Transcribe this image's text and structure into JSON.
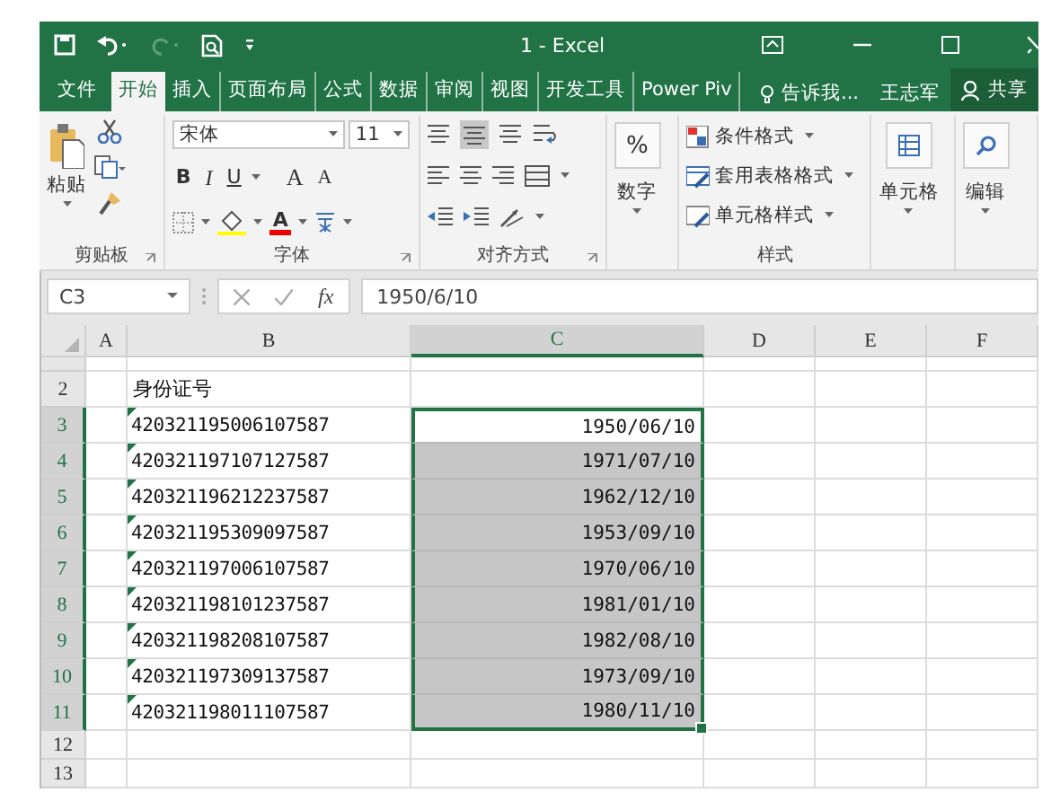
{
  "window": {
    "title": "1 - Excel"
  },
  "tabs": [
    {
      "label": "文件",
      "selected": false
    },
    {
      "label": "开始",
      "selected": true
    },
    {
      "label": "插入",
      "selected": false
    },
    {
      "label": "页面布局",
      "selected": false
    },
    {
      "label": "公式",
      "selected": false
    },
    {
      "label": "数据",
      "selected": false
    },
    {
      "label": "审阅",
      "selected": false
    },
    {
      "label": "视图",
      "selected": false
    },
    {
      "label": "开发工具",
      "selected": false
    },
    {
      "label": "Power Piv",
      "selected": false
    }
  ],
  "tell_me": "告诉我...",
  "user": "王志军",
  "share": "共享",
  "ribbon": {
    "clipboard": {
      "paste": "粘贴",
      "label": "剪贴板"
    },
    "font": {
      "font_name": "宋体",
      "font_size": "11",
      "bold": "B",
      "italic": "I",
      "underline": "U",
      "grow": "A",
      "shrink": "A",
      "font_color": "A",
      "label": "字体"
    },
    "alignment": {
      "label": "对齐方式"
    },
    "number": {
      "symbol": "%",
      "label": "数字"
    },
    "styles": {
      "items": [
        "条件格式",
        "套用表格格式",
        "单元格样式"
      ],
      "label": "样式"
    },
    "cells": {
      "label": "单元格"
    },
    "editing": {
      "label": "编辑"
    }
  },
  "formula_bar": {
    "name_box": "C3",
    "fx": "fx",
    "value": "1950/6/10"
  },
  "sheet": {
    "columns": [
      {
        "label": "A",
        "selected": false
      },
      {
        "label": "B",
        "selected": false
      },
      {
        "label": "C",
        "selected": true
      },
      {
        "label": "D",
        "selected": false
      },
      {
        "label": "E",
        "selected": false
      },
      {
        "label": "F",
        "selected": false
      }
    ],
    "rows": [
      {
        "header": "2",
        "selected": false,
        "id": "身份证号",
        "date": "",
        "flag": false,
        "cell_selected": false,
        "active": false
      },
      {
        "header": "3",
        "selected": true,
        "id": "420321195006107587",
        "date": "1950/06/10",
        "flag": true,
        "cell_selected": true,
        "active": true
      },
      {
        "header": "4",
        "selected": true,
        "id": "420321197107127587",
        "date": "1971/07/10",
        "flag": true,
        "cell_selected": true,
        "active": false
      },
      {
        "header": "5",
        "selected": true,
        "id": "420321196212237587",
        "date": "1962/12/10",
        "flag": true,
        "cell_selected": true,
        "active": false
      },
      {
        "header": "6",
        "selected": true,
        "id": "420321195309097587",
        "date": "1953/09/10",
        "flag": true,
        "cell_selected": true,
        "active": false
      },
      {
        "header": "7",
        "selected": true,
        "id": "420321197006107587",
        "date": "1970/06/10",
        "flag": true,
        "cell_selected": true,
        "active": false
      },
      {
        "header": "8",
        "selected": true,
        "id": "420321198101237587",
        "date": "1981/01/10",
        "flag": true,
        "cell_selected": true,
        "active": false
      },
      {
        "header": "9",
        "selected": true,
        "id": "420321198208107587",
        "date": "1982/08/10",
        "flag": true,
        "cell_selected": true,
        "active": false
      },
      {
        "header": "10",
        "selected": true,
        "id": "420321197309137587",
        "date": "1973/09/10",
        "flag": true,
        "cell_selected": true,
        "active": false
      },
      {
        "header": "11",
        "selected": true,
        "id": "420321198011107587",
        "date": "1980/11/10",
        "flag": true,
        "cell_selected": true,
        "active": false
      },
      {
        "header": "12",
        "selected": false,
        "id": "",
        "date": "",
        "flag": false,
        "cell_selected": false,
        "active": false
      },
      {
        "header": "13",
        "selected": false,
        "id": "",
        "date": "",
        "flag": false,
        "cell_selected": false,
        "active": false
      }
    ]
  }
}
